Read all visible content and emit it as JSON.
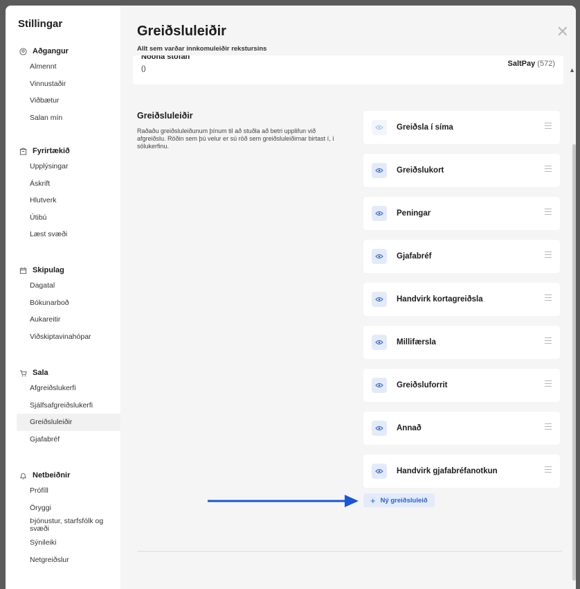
{
  "sidebar": {
    "title": "Stillingar",
    "sections": [
      {
        "title": "Aðgangur",
        "icon": "user-circle-icon",
        "items": [
          "Almennt",
          "Vinnustaðir",
          "Viðbætur",
          "Salan mín"
        ]
      },
      {
        "title": "Fyrirtækið",
        "icon": "building-icon",
        "items": [
          "Upplýsingar",
          "Áskrift",
          "Hlutverk",
          "Útibú",
          "Læst svæði"
        ]
      },
      {
        "title": "Skipulag",
        "icon": "calendar-icon",
        "items": [
          "Dagatal",
          "Bókunarboð",
          "Aukareitir",
          "Viðskiptavinahópar"
        ]
      },
      {
        "title": "Sala",
        "icon": "cart-icon",
        "items": [
          "Afgreiðslukerfi",
          "Sjálfsafgreiðslukerfi",
          "Greiðsluleiðir",
          "Gjafabréf"
        ]
      },
      {
        "title": "Netbeiðnir",
        "icon": "bell-icon",
        "items": [
          "Prófíll",
          "Öryggi",
          "Þjónustur, starfsfólk og svæði",
          "Sýnileiki",
          "Netgreiðslur"
        ]
      }
    ],
    "active_item": "Greiðsluleiðir"
  },
  "header": {
    "title": "Greiðsluleiðir",
    "subtitle": "Allt sem varðar innkomuleiðir rekstursins"
  },
  "top_card": {
    "name": "Noona stofan",
    "paren": "()",
    "brand": "SaltPay",
    "brand_suffix": " (572)"
  },
  "section": {
    "title": "Greiðsluleiðir",
    "description": "Raðaðu greiðsluleiðunum þínum til að stuðla að betri upplifun við afgreiðslu. Röðin sem þú velur er sú röð sem greiðsluleiðirnar birtast í, í sölukerfinu."
  },
  "payment_methods": [
    {
      "label": "Greiðsla í síma",
      "visible": false
    },
    {
      "label": "Greiðslukort",
      "visible": true
    },
    {
      "label": "Peningar",
      "visible": true
    },
    {
      "label": "Gjafabréf",
      "visible": true
    },
    {
      "label": "Handvirk kortagreiðsla",
      "visible": true
    },
    {
      "label": "Millifærsla",
      "visible": true
    },
    {
      "label": "Greiðsluforrit",
      "visible": true
    },
    {
      "label": "Annað",
      "visible": true
    },
    {
      "label": "Handvirk gjafabréfanotkun",
      "visible": true
    }
  ],
  "add_button": {
    "plus": "+",
    "label": "Ný greiðsluleið"
  },
  "colors": {
    "accent": "#2c5fcf",
    "accent_bg": "#e3ebfb",
    "arrow": "#1a56d6"
  }
}
